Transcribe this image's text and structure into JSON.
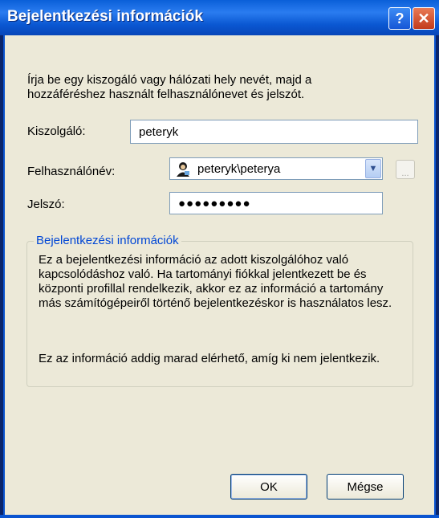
{
  "window": {
    "title": "Bejelentkezési információk"
  },
  "titlebar_buttons": {
    "help": "?",
    "close": "✕"
  },
  "intro_text": "Írja be egy kiszogáló vagy hálózati hely nevét, majd a hozzáféréshez használt felhasználónevet és jelszót.",
  "form": {
    "server_label": "Kiszolgáló:",
    "server_value": "peteryk",
    "username_label": "Felhasználónév:",
    "username_value": "peteryk\\peterya",
    "password_label": "Jelszó:",
    "password_value": "●●●●●●●●●",
    "browse_label": "..."
  },
  "group": {
    "title": "Bejelentkezési információk",
    "paragraph1": "Ez a bejelentkezési információ az adott kiszolgálóhoz való kapcsolódáshoz való. Ha tartományi fiókkal jelentkezett be és központi profillal rendelkezik, akkor ez az információ a tartomány más számítógépeiről történő bejelentkezéskor is használatos lesz.",
    "paragraph2": "Ez az információ addig marad elérhető, amíg ki nem jelentkezik."
  },
  "buttons": {
    "ok": "OK",
    "cancel": "Mégse"
  },
  "icons": {
    "user": "user-icon",
    "dropdown": "chevron-down-icon",
    "help": "help-icon",
    "close": "close-icon"
  },
  "colors": {
    "titlebar": "#0a5fd8",
    "dialog_bg": "#ece9d8",
    "group_title": "#0046d5"
  }
}
